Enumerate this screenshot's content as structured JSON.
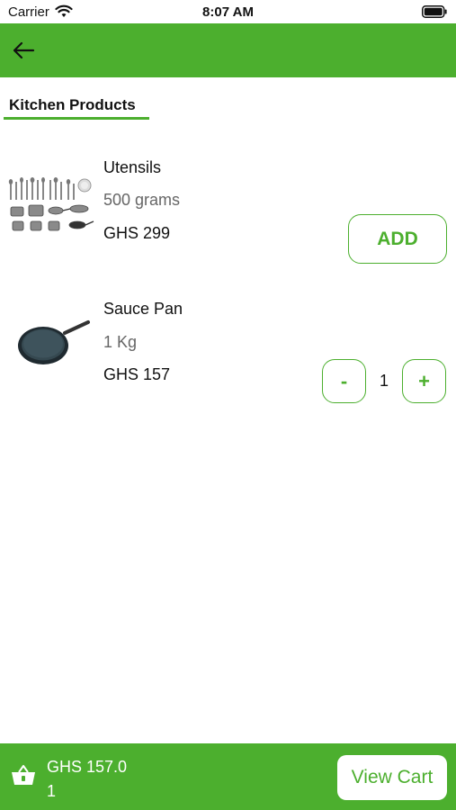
{
  "status_bar": {
    "carrier": "Carrier",
    "time": "8:07 AM"
  },
  "app_bar": {
    "back_icon": "arrow-left-icon",
    "color": "#4caf2e"
  },
  "tab": {
    "label": "Kitchen Products",
    "underline_color": "#4caf2e"
  },
  "products": [
    {
      "name": "Utensils",
      "weight": "500 grams",
      "price": "GHS 299",
      "image_icon": "utensils-image",
      "action_label": "ADD"
    },
    {
      "name": "Sauce Pan",
      "weight": "1 Kg",
      "price": "GHS 157",
      "image_icon": "sauce-pan-image",
      "decrement_label": "-",
      "quantity": "1",
      "increment_label": "+"
    }
  ],
  "bottom_bar": {
    "basket_icon": "basket-icon",
    "total": "GHS 157.0",
    "count": "1",
    "view_cart_label": "View Cart"
  }
}
